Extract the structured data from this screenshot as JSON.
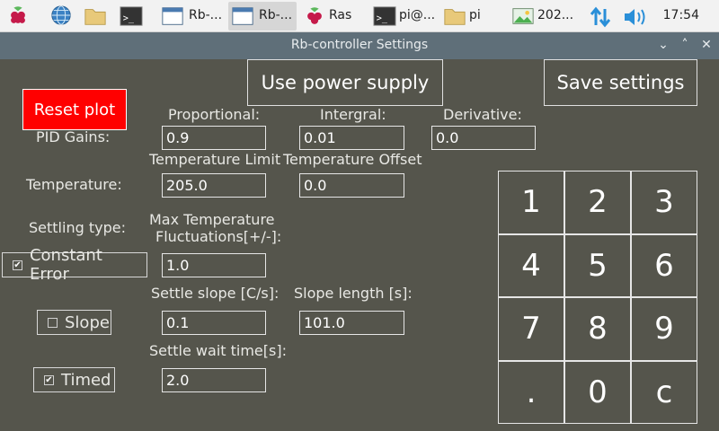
{
  "taskbar": {
    "items": [
      {
        "label": "",
        "icon": "raspberry-menu-icon"
      },
      {
        "label": "",
        "icon": "web-browser-icon"
      },
      {
        "label": "",
        "icon": "file-manager-icon"
      },
      {
        "label": "",
        "icon": "terminal-icon"
      },
      {
        "label": "Rb-...",
        "icon": "window-icon"
      },
      {
        "label": "Rb-...",
        "icon": "window-icon"
      },
      {
        "label": "Ras",
        "icon": "raspberry-icon"
      },
      {
        "label": "pi@...",
        "icon": "terminal-icon"
      },
      {
        "label": "pi",
        "icon": "folder-icon"
      },
      {
        "label": "202...",
        "icon": "image-viewer-icon"
      }
    ],
    "clock": "17:54"
  },
  "window": {
    "title": "Rb-controller Settings",
    "controls": {
      "collapse": "⌄",
      "maximize": "˄",
      "close": "✕"
    }
  },
  "toolbar": {
    "reset_plot": "Reset plot",
    "use_power_supply": "Use power supply",
    "save_settings": "Save settings"
  },
  "pid": {
    "label": "PID Gains:",
    "proportional_label": "Proportional:",
    "integral_label": "Intergral:",
    "derivative_label": "Derivative:",
    "proportional": "0.9",
    "integral": "0.01",
    "derivative": "0.0"
  },
  "temperature": {
    "label": "Temperature:",
    "limit_label": "Temperature Limit",
    "offset_label": "Temperature Offset",
    "limit": "205.0",
    "offset": "0.0"
  },
  "settling": {
    "label": "Settling type:",
    "max_fluct_label_1": "Max Temperature",
    "max_fluct_label_2": "Fluctuations[+/-]:",
    "constant_error": {
      "label": "Constant Error",
      "checked": true
    },
    "max_fluct": "1.0",
    "slope": {
      "label": "Slope",
      "checked": false
    },
    "slope_label": "Settle slope [C/s]:",
    "slope_value": "0.1",
    "slope_length_label": "Slope length [s]:",
    "slope_length": "101.0",
    "timed": {
      "label": "Timed",
      "checked": true
    },
    "wait_label": "Settle wait time[s]:",
    "wait_value": "2.0"
  },
  "keypad": {
    "keys": [
      "1",
      "2",
      "3",
      "4",
      "5",
      "6",
      "7",
      "8",
      "9",
      ".",
      "0",
      "c"
    ]
  }
}
